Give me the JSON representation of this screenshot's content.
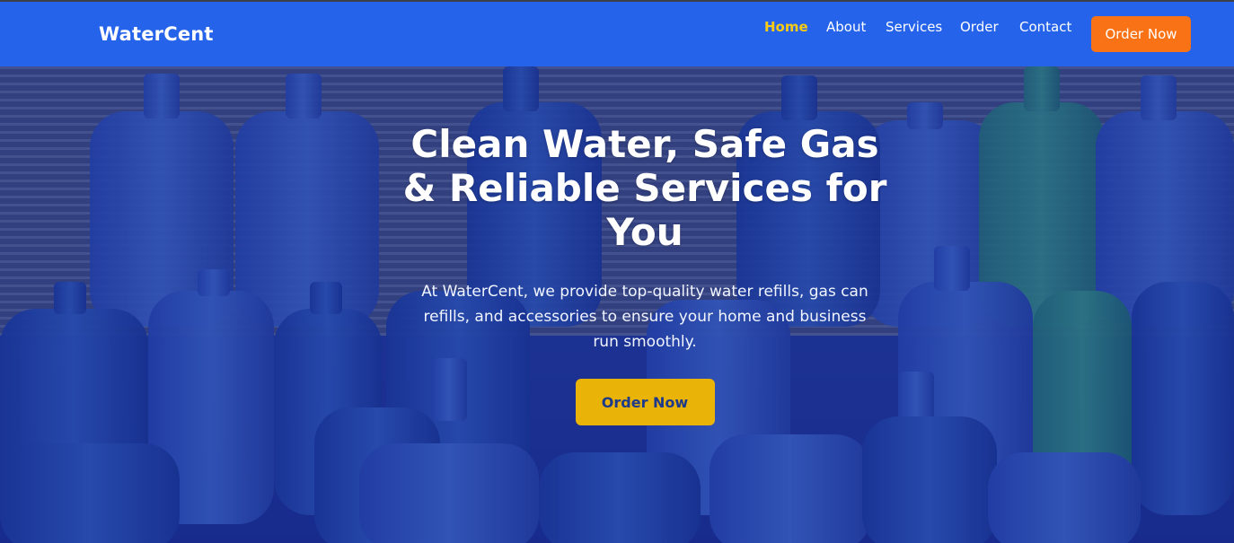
{
  "brand": {
    "name": "WaterCent"
  },
  "nav": {
    "links": [
      {
        "label": "Home",
        "active": true
      },
      {
        "label": "About",
        "active": false
      },
      {
        "label": "Services",
        "active": false
      },
      {
        "label": "Order",
        "active": false
      },
      {
        "label": "Contact",
        "active": false
      }
    ],
    "cta_label": "Order Now"
  },
  "hero": {
    "title": "Clean Water, Safe Gas & Reliable Services for You",
    "text": "At WaterCent, we provide top-quality water refills, gas can refills, and accessories to ensure your home and business run smoothly.",
    "cta_label": "Order Now",
    "background_image": "water-bottles-photo"
  },
  "colors": {
    "navbar": "#2563eb",
    "nav_active": "#facc15",
    "nav_cta": "#f97316",
    "hero_cta": "#eab308",
    "hero_cta_text": "#1e3a8a"
  }
}
